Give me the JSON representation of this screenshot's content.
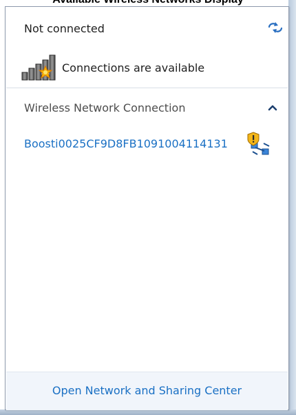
{
  "caption": "Available Wireless Networks Display",
  "status": {
    "title": "Not connected",
    "availability_text": "Connections are available"
  },
  "section": {
    "title": "Wireless Network Connection",
    "expanded": true
  },
  "networks": [
    {
      "name": "Boosti0025CF9D8FB1091004114131",
      "secured": true
    }
  ],
  "footer": {
    "link_label": "Open Network and Sharing Center"
  },
  "colors": {
    "link": "#1a70c4",
    "footer_bg": "#f1f5fb",
    "border": "#8e9aad"
  },
  "icons": {
    "refresh": "refresh-arrows-icon",
    "signal": "signal-bars-available-icon",
    "chevron": "chevron-up-icon",
    "network": "secured-network-icon"
  }
}
